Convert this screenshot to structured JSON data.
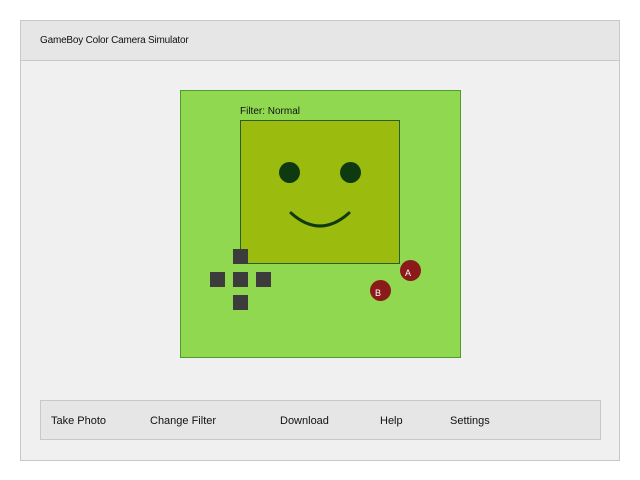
{
  "app": {
    "title": "GameBoy Color Camera Simulator"
  },
  "camera": {
    "filter_label": "Filter: Normal",
    "screen_content": "smiley-face",
    "buttons": {
      "a_label": "A",
      "b_label": "B"
    }
  },
  "toolbar": {
    "take_photo": "Take Photo",
    "change_filter": "Change Filter",
    "download": "Download",
    "help": "Help",
    "settings": "Settings"
  },
  "colors": {
    "device_body": "#90d850",
    "screen": "#9bbb0e",
    "screen_dark": "#0f3a0f",
    "button_red": "#8b1a1a",
    "dpad": "#3c3c3c"
  }
}
